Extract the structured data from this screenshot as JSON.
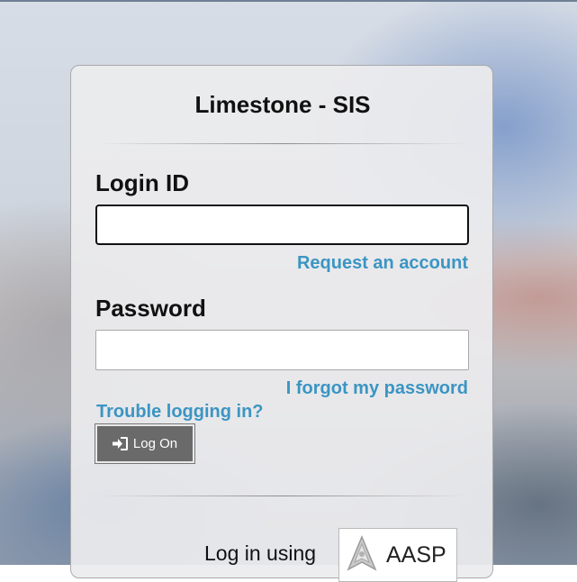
{
  "form": {
    "title": "Limestone - SIS",
    "login_id_label": "Login ID",
    "login_id_value": "",
    "request_account_link": "Request an account",
    "password_label": "Password",
    "password_value": "",
    "forgot_password_link": "I forgot my password",
    "trouble_link": "Trouble logging in?",
    "logon_button_label": "Log On",
    "logon_icon": "sign-in-icon",
    "login_using_label": "Log in using",
    "sso_provider_label": "AASP",
    "sso_icon": "aasp-logo-icon"
  },
  "colors": {
    "link": "#3b95c3",
    "button_bg": "#6a6a6a",
    "card_bg": "#ececee"
  }
}
